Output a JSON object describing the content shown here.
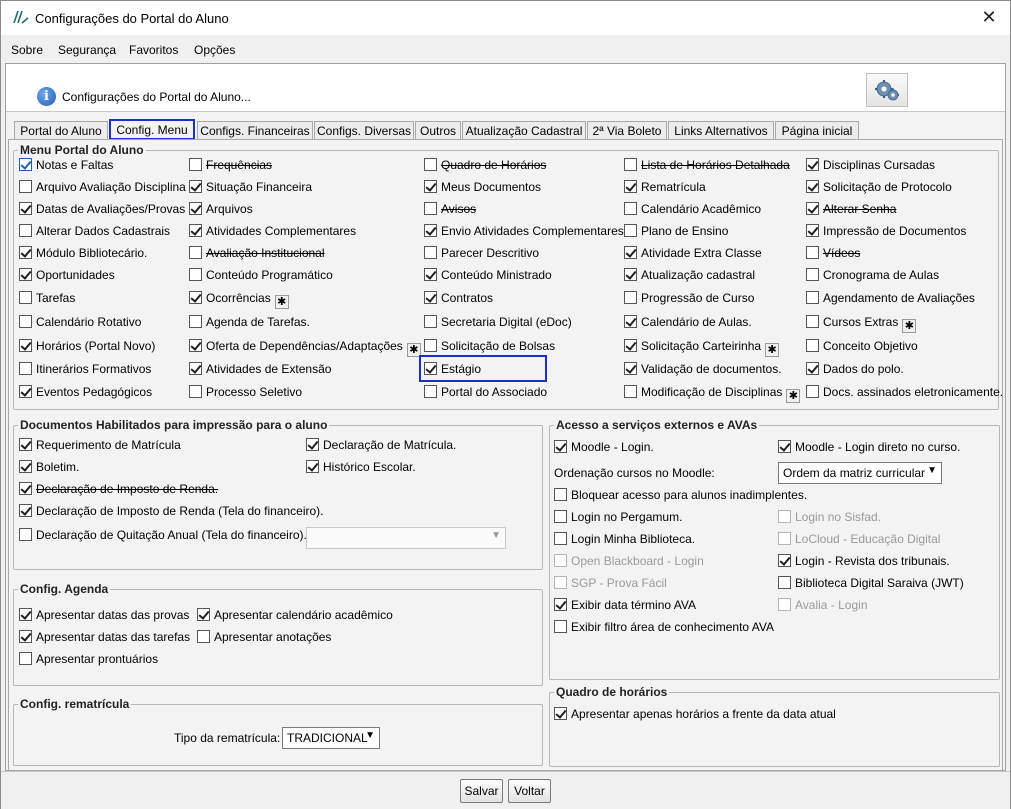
{
  "window": {
    "title": "Configurações do Portal do Aluno",
    "close_glyph": "✕"
  },
  "menubar": [
    "Sobre",
    "Segurança",
    "Favoritos",
    "Opções"
  ],
  "header": {
    "text": "Configurações do Portal do Aluno..."
  },
  "tabs": [
    "Portal do Aluno",
    "Config. Menu",
    "Configs. Financeiras",
    "Configs. Diversas",
    "Outros",
    "Atualização Cadastral",
    "2ª Via Boleto",
    "Links Alternativos",
    "Página inicial"
  ],
  "active_tab": "Config. Menu",
  "menu_group": {
    "title": "Menu Portal do Aluno",
    "columns": [
      [
        {
          "label": "Notas e Faltas",
          "checked": true,
          "primary": true
        },
        {
          "label": "Arquivo Avaliação Disciplina",
          "checked": false
        },
        {
          "label": "Datas de Avaliações/Provas",
          "checked": true
        },
        {
          "label": "Alterar Dados Cadastrais",
          "checked": false
        },
        {
          "label": "Módulo Bibliotecário.",
          "checked": true
        },
        {
          "label": "Oportunidades",
          "checked": true
        },
        {
          "label": "Tarefas",
          "checked": false
        },
        {
          "label": "Calendário Rotativo",
          "checked": false
        },
        {
          "label": "Horários (Portal Novo)",
          "checked": true
        },
        {
          "label": "Itinerários Formativos",
          "checked": false
        },
        {
          "label": "Eventos Pedagógicos",
          "checked": true
        }
      ],
      [
        {
          "label": "Frequências",
          "checked": false,
          "strike": true
        },
        {
          "label": "Situação Financeira",
          "checked": true
        },
        {
          "label": "Arquivos",
          "checked": true
        },
        {
          "label": "Atividades Complementares",
          "checked": true
        },
        {
          "label": "Avaliação Institucional",
          "checked": false,
          "strike": true
        },
        {
          "label": "Conteúdo Programático",
          "checked": false
        },
        {
          "label": "Ocorrências",
          "checked": true,
          "gear": true
        },
        {
          "label": "Agenda de Tarefas.",
          "checked": false
        },
        {
          "label": "Oferta de Dependências/Adaptações",
          "checked": true,
          "gear": true
        },
        {
          "label": "Atividades de Extensão",
          "checked": true
        },
        {
          "label": "Processo Seletivo",
          "checked": false
        }
      ],
      [
        {
          "label": "Quadro de Horários",
          "checked": false,
          "strike": true
        },
        {
          "label": "Meus Documentos",
          "checked": true
        },
        {
          "label": "Avisos",
          "checked": false,
          "strike": true
        },
        {
          "label": "Envio Atividades Complementares",
          "checked": true
        },
        {
          "label": "Parecer Descritivo",
          "checked": false
        },
        {
          "label": "Conteúdo Ministrado",
          "checked": true
        },
        {
          "label": "Contratos",
          "checked": true
        },
        {
          "label": "Secretaria Digital (eDoc)",
          "checked": false
        },
        {
          "label": "Solicitação de Bolsas",
          "checked": false
        },
        {
          "label": "Estágio",
          "checked": true,
          "highlight": true
        },
        {
          "label": "Portal do Associado",
          "checked": false
        }
      ],
      [
        {
          "label": "Lista de Horários Detalhada",
          "checked": false,
          "strike": true
        },
        {
          "label": "Rematrícula",
          "checked": true
        },
        {
          "label": "Calendário Acadêmico",
          "checked": false
        },
        {
          "label": "Plano de Ensino",
          "checked": false
        },
        {
          "label": "Atividade Extra Classe",
          "checked": true
        },
        {
          "label": "Atualização cadastral",
          "checked": true
        },
        {
          "label": "Progressão de Curso",
          "checked": false
        },
        {
          "label": "Calendário de Aulas.",
          "checked": true
        },
        {
          "label": "Solicitação Carteirinha",
          "checked": true,
          "gear": true
        },
        {
          "label": "Validação de documentos.",
          "checked": true
        },
        {
          "label": "Modificação de Disciplinas",
          "checked": false,
          "gear": true
        }
      ],
      [
        {
          "label": "Disciplinas Cursadas",
          "checked": true
        },
        {
          "label": "Solicitação de Protocolo",
          "checked": true
        },
        {
          "label": "Alterar Senha",
          "checked": true,
          "strike": true
        },
        {
          "label": "Impressão de Documentos",
          "checked": true
        },
        {
          "label": "Vídeos",
          "checked": false,
          "strike": true
        },
        {
          "label": "Cronograma de Aulas",
          "checked": false
        },
        {
          "label": "Agendamento de Avaliações",
          "checked": false
        },
        {
          "label": "Cursos Extras",
          "checked": false,
          "gear": true
        },
        {
          "label": "Conceito Objetivo",
          "checked": false
        },
        {
          "label": "Dados do polo.",
          "checked": true
        },
        {
          "label": "Docs. assinados eletronicamente.",
          "checked": false
        }
      ]
    ]
  },
  "docs_group": {
    "title": "Documentos Habilitados para impressão para o aluno",
    "left": [
      {
        "label": "Requerimento de Matrícula",
        "checked": true
      },
      {
        "label": "Boletim.",
        "checked": true
      },
      {
        "label": "Declaração de Imposto de Renda.",
        "checked": true,
        "strike": true
      },
      {
        "label": "Declaração de Imposto de Renda (Tela do financeiro).",
        "checked": true
      },
      {
        "label": "Declaração de Quitação Anual (Tela do financeiro).",
        "checked": false
      }
    ],
    "right": [
      {
        "label": "Declaração de Matrícula.",
        "checked": true
      },
      {
        "label": "Histórico Escolar.",
        "checked": true
      }
    ],
    "combo_value": ""
  },
  "agenda_group": {
    "title": "Config. Agenda",
    "items": [
      {
        "label": "Apresentar datas das provas",
        "checked": true
      },
      {
        "label": "Apresentar calendário acadêmico",
        "checked": true
      },
      {
        "label": "Apresentar datas das tarefas",
        "checked": true
      },
      {
        "label": "Apresentar anotações",
        "checked": false
      },
      {
        "label": "Apresentar prontuários",
        "checked": false
      }
    ]
  },
  "rematricula_group": {
    "title": "Config. rematrícula",
    "type_label": "Tipo da rematrícula:",
    "type_value": "TRADICIONAL"
  },
  "external_group": {
    "title": "Acesso a serviços externos e AVAs",
    "moodle_login": {
      "label": "Moodle - Login.",
      "checked": true
    },
    "moodle_direct": {
      "label": "Moodle - Login direto no curso.",
      "checked": true
    },
    "order_label": "Ordenação cursos no Moodle:",
    "order_value": "Ordem da matriz curricular",
    "block": {
      "label": "Bloquear acesso para alunos inadimplentes.",
      "checked": false
    },
    "left": [
      {
        "label": "Login no Pergamum.",
        "checked": false
      },
      {
        "label": "Login Minha Biblioteca.",
        "checked": false
      },
      {
        "label": "Open Blackboard - Login",
        "checked": false,
        "disabled": true
      },
      {
        "label": "SGP - Prova Fácil",
        "checked": false,
        "disabled": true
      },
      {
        "label": "Exibir data término AVA",
        "checked": true
      },
      {
        "label": "Exibir filtro área de conhecimento AVA",
        "checked": false
      }
    ],
    "right": [
      {
        "label": "Login no Sisfad.",
        "checked": false,
        "disabled": true
      },
      {
        "label": "LoCloud - Educação Digital",
        "checked": false,
        "disabled": true
      },
      {
        "label": "Login - Revista dos tribunais.",
        "checked": true
      },
      {
        "label": "Biblioteca Digital Saraiva (JWT)",
        "checked": false
      },
      {
        "label": "Avalia - Login",
        "checked": false,
        "disabled": true
      }
    ]
  },
  "schedule_group": {
    "title": "Quadro de horários",
    "item": {
      "label": "Apresentar apenas horários a frente da data atual",
      "checked": true
    }
  },
  "buttons": {
    "save": "Salvar",
    "back": "Voltar"
  },
  "icons": {
    "gear_glyph": "✱",
    "info_glyph": "i",
    "arrow_glyph": "▼"
  }
}
